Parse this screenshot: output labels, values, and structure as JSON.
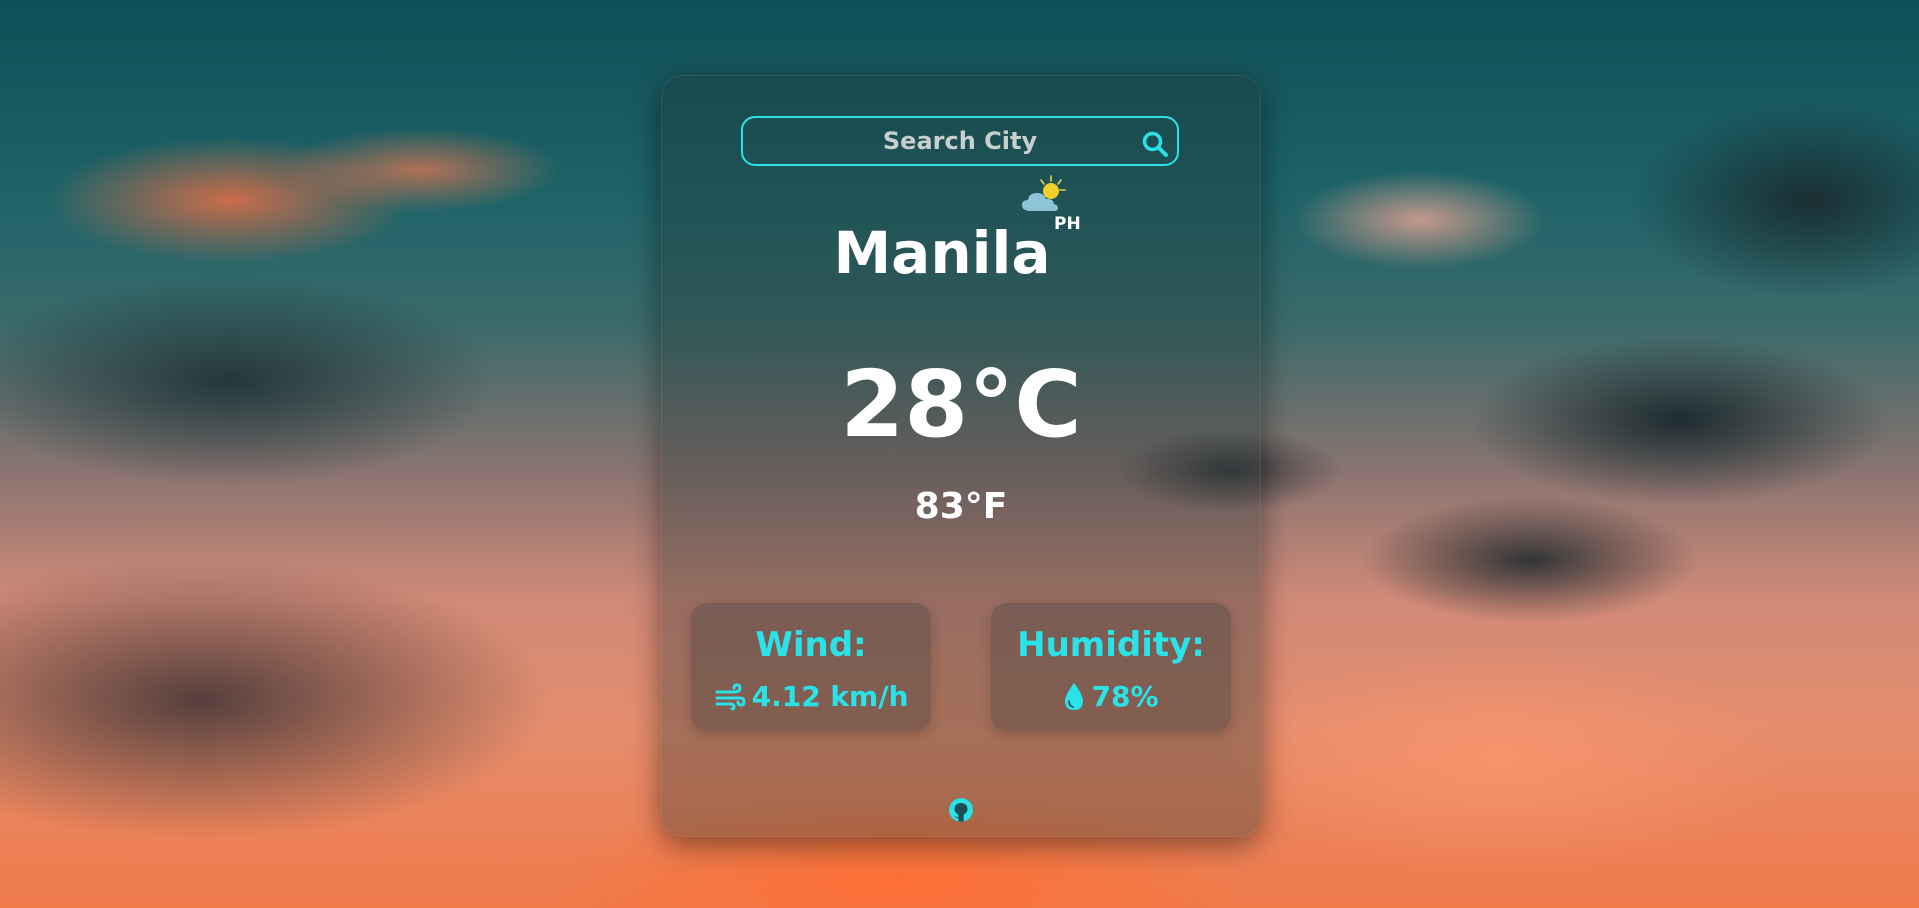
{
  "search": {
    "placeholder": "Search City"
  },
  "weather": {
    "city": "Manila",
    "country": "PH",
    "temp_c": "28°C",
    "temp_f": "83°F",
    "condition_icon": "partly-cloudy-icon"
  },
  "stats": {
    "wind": {
      "label": "Wind:",
      "value": "4.12 km/h",
      "icon": "wind-icon"
    },
    "humidity": {
      "label": "Humidity:",
      "value": "78%",
      "icon": "droplet-icon"
    }
  },
  "footer": {
    "icon": "github-icon"
  },
  "colors": {
    "accent": "#29e3e8",
    "text": "#ffffff"
  }
}
